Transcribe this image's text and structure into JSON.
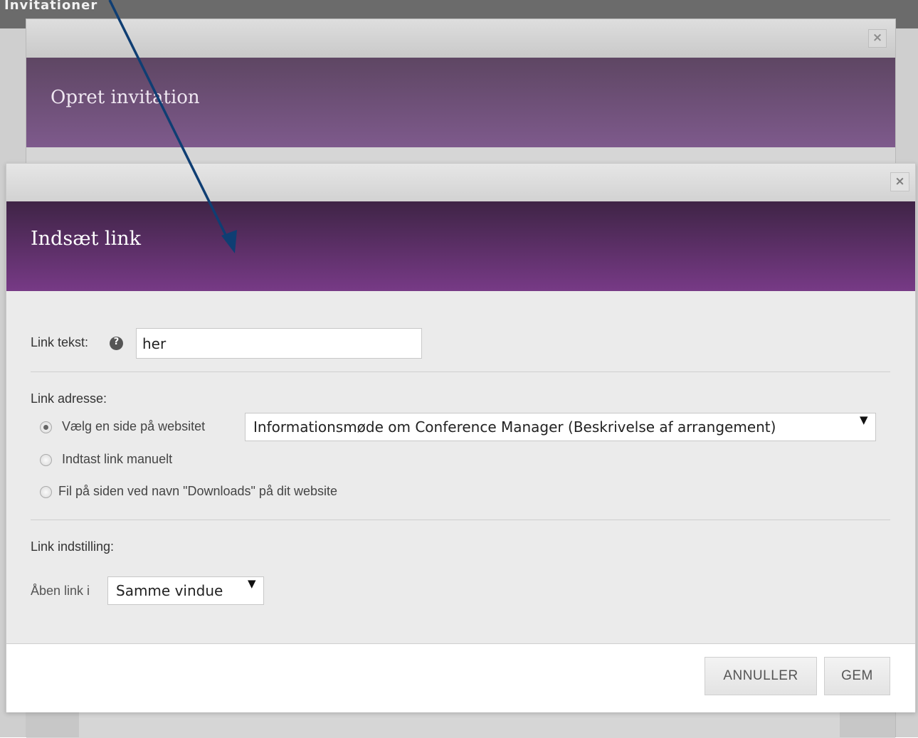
{
  "background": {
    "header_title": "Invitationer"
  },
  "outer_modal": {
    "title": "Opret invitation",
    "close_icon": "×"
  },
  "link_modal": {
    "title": "Indsæt link",
    "close_icon": "×",
    "link_text": {
      "label": "Link tekst:",
      "help_icon": "?",
      "value": "her"
    },
    "link_address": {
      "label": "Link adresse:",
      "options": [
        {
          "label": "Vælg en side på websitet",
          "checked": true
        },
        {
          "label": "Indtast link manuelt",
          "checked": false
        },
        {
          "label": "Fil på siden ved navn \"Downloads\" på dit website",
          "checked": false
        }
      ],
      "page_select_value": "Informationsmøde om Conference Manager (Beskrivelse af arrangement)"
    },
    "link_settings": {
      "label": "Link indstilling:",
      "open_label": "Åben link i",
      "open_select_value": "Samme vindue"
    },
    "footer": {
      "cancel_label": "ANNULLER",
      "save_label": "GEM"
    }
  },
  "colors": {
    "outer_header": "#7e5a8c",
    "inner_header": "#773a86",
    "annotation_arrow": "#0f3e73"
  },
  "select_arrow_icon": "▼"
}
